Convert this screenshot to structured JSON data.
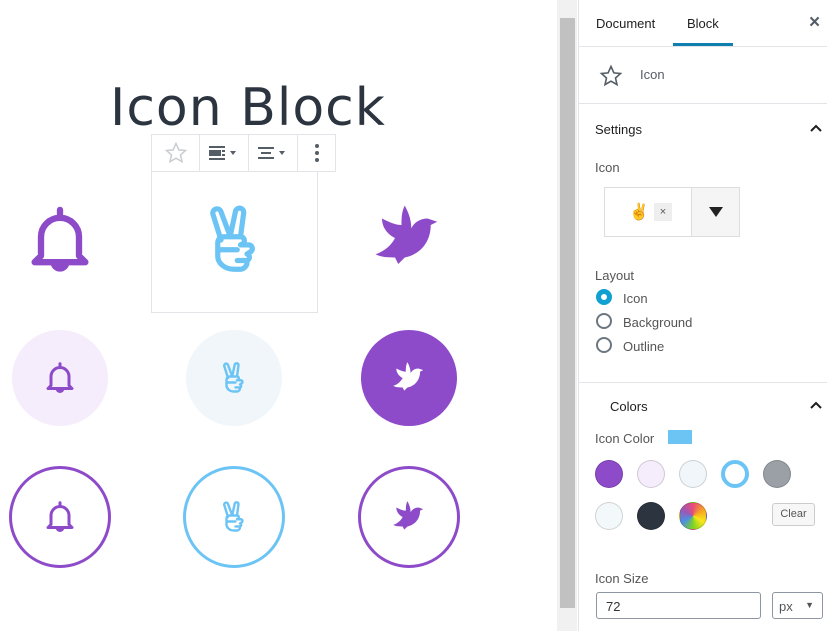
{
  "editor": {
    "title": "Icon Block"
  },
  "toolbar": {
    "icons": [
      "star-icon",
      "align-left-media-icon",
      "align-center-icon",
      "more-vertical-icon"
    ]
  },
  "icons": [
    "bell-icon",
    "peace-hand-icon",
    "dove-icon"
  ],
  "colors": {
    "purple": "#8e4bc9",
    "light_purple": "#f5ecfc",
    "light_blue": "#f0f6fa",
    "blue": "#6cc4f5",
    "dark": "#2c3440",
    "gray": "#9aa0a6"
  },
  "sidebar": {
    "tabs": [
      {
        "label": "Document"
      },
      {
        "label": "Block",
        "active": true
      }
    ],
    "close": "×",
    "block": {
      "name": "Icon"
    },
    "settings": {
      "title": "Settings",
      "icon_label": "Icon",
      "selected_icon": "✌",
      "remove": "×",
      "layout_label": "Layout",
      "layout_options": [
        {
          "label": "Icon",
          "checked": true
        },
        {
          "label": "Background",
          "checked": false
        },
        {
          "label": "Outline",
          "checked": false
        }
      ]
    },
    "colors": {
      "title": "Colors",
      "icon_color_label": "Icon Color",
      "icon_color": "#6cc4f5",
      "swatches": [
        "#8e4bc9",
        "#f5ecfc",
        "#f0f6fa",
        "#6cc4f5",
        "#9aa0a6",
        "#f3f8fb",
        "#2c3440",
        "gradient"
      ],
      "selected_swatch": "#6cc4f5",
      "clear": "Clear"
    },
    "size": {
      "label": "Icon Size",
      "value": "72",
      "unit": "px"
    }
  }
}
